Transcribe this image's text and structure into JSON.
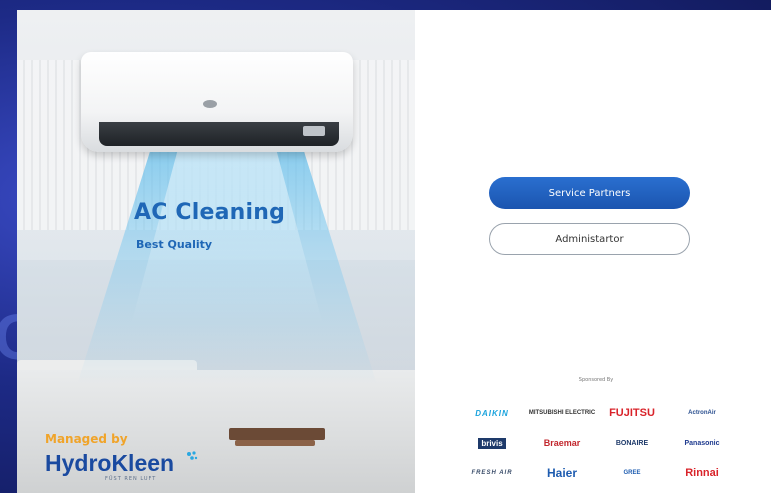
{
  "hero": {
    "title": "AC Cleaning",
    "subtitle": "Best Quality",
    "managed_label": "Managed by",
    "brand_name": "HydroKleen",
    "brand_tagline": "FÜST REN LUFT"
  },
  "actions": {
    "service_partners_label": "Service Partners",
    "administrator_label": "Administartor"
  },
  "sponsors": {
    "label": "Sponsored By",
    "logos": [
      "DAIKIN",
      "MITSUBISHI ELECTRIC",
      "FUJITSU",
      "ActronAir",
      "brivis",
      "Braemar",
      "BONAIRE",
      "Panasonic",
      "FRESH AIR",
      "Haier",
      "GREE",
      "Rinnai"
    ]
  },
  "colors": {
    "primary_blue": "#1f67b6",
    "button_blue": "#1b55b0",
    "managed_orange": "#f0a42a",
    "background_navy": "#1d2a86"
  }
}
